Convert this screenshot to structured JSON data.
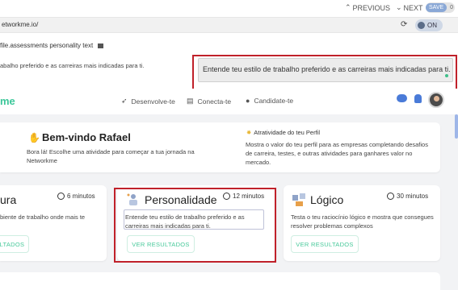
{
  "topbar": {
    "previous_label": "PREVIOUS",
    "next_label": "NEXT",
    "save_label": "SAVE",
    "save_count": "0"
  },
  "urlbar": {
    "url": "etworkme.io/",
    "toggle_label": "ON"
  },
  "inspector": {
    "selector": "file.assessments personality text",
    "preview_text": "abalho preferido e as carreiras mais indicadas para ti.",
    "highlight_text": "Entende teu estilo de trabalho preferido e as carreiras mais indicadas para ti."
  },
  "app_nav": {
    "logo_fragment": "me",
    "links": [
      {
        "label": "Desenvolve-te",
        "icon": "rocket-icon"
      },
      {
        "label": "Conecta-te",
        "icon": "id-card-icon"
      },
      {
        "label": "Candidate-te",
        "icon": "user-icon"
      }
    ]
  },
  "welcome": {
    "title": "Bem-vindo Rafael",
    "subtitle": "Bora lá! Escolhe uma atividade para começar a tua jornada na Networkme",
    "activity_title": "Atratividade do teu Perfil",
    "activity_text": "Mostra o valor do teu perfil para as empresas completando desafios de carreira, testes, e outras atividades para ganhares valor no mercado."
  },
  "cards": [
    {
      "title": "ura",
      "time": "6 minutos",
      "description": "biente de trabalho onde mais te",
      "button": "LTADOS"
    },
    {
      "title": "Personalidade",
      "time": "12 minutos",
      "description": "Entende teu estilo de trabalho preferido e as carreiras mais indicadas para ti.",
      "button": "VER RESULTADOS"
    },
    {
      "title": "Lógico",
      "time": "30 minutos",
      "description": "Testa o teu raciocínio lógico e mostra que consegues resolver problemas complexos",
      "button": "VER RESULTADOS"
    }
  ],
  "colors": {
    "brand_green": "#3cc79a",
    "highlight_red": "#c0212a",
    "accent_blue": "#4a7bd8"
  }
}
